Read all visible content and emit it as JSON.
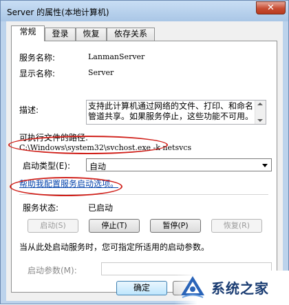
{
  "window": {
    "title": "Server 的属性(本地计算机)",
    "close_glyph": "✕"
  },
  "tabs": [
    {
      "label": "常规",
      "active": true
    },
    {
      "label": "登录",
      "active": false
    },
    {
      "label": "恢复",
      "active": false
    },
    {
      "label": "依存关系",
      "active": false
    }
  ],
  "general": {
    "service_name_label": "服务名称:",
    "service_name_value": "LanmanServer",
    "display_name_label": "显示名称:",
    "display_name_value": "Server",
    "description_label": "描述:",
    "description_value": "支持此计算机通过网络的文件、打印、和命名管道共享。如果服务停止，这些功能不可用。",
    "exe_path_label": "可执行文件的路径:",
    "exe_path_value": "C:\\Windows\\system32\\svchost.exe -k netsvcs",
    "startup_type_label": "启动类型(E):",
    "startup_type_value": "自动",
    "help_link": "帮助我配置服务启动选项。",
    "service_status_label": "服务状态:",
    "service_status_value": "已启动",
    "buttons": {
      "start": "启动(S)",
      "stop": "停止(T)",
      "pause": "暂停(P)",
      "resume": "恢复(R)"
    },
    "hint": "当从此处启动服务时，您可指定所适用的启动参数。",
    "start_params_label": "启动参数(M):",
    "start_params_value": ""
  },
  "footer": {
    "ok_label": "确定"
  },
  "watermark": {
    "text": "系统之家"
  },
  "colors": {
    "annotation_red": "#d0201a",
    "link_blue": "#0645ad"
  }
}
